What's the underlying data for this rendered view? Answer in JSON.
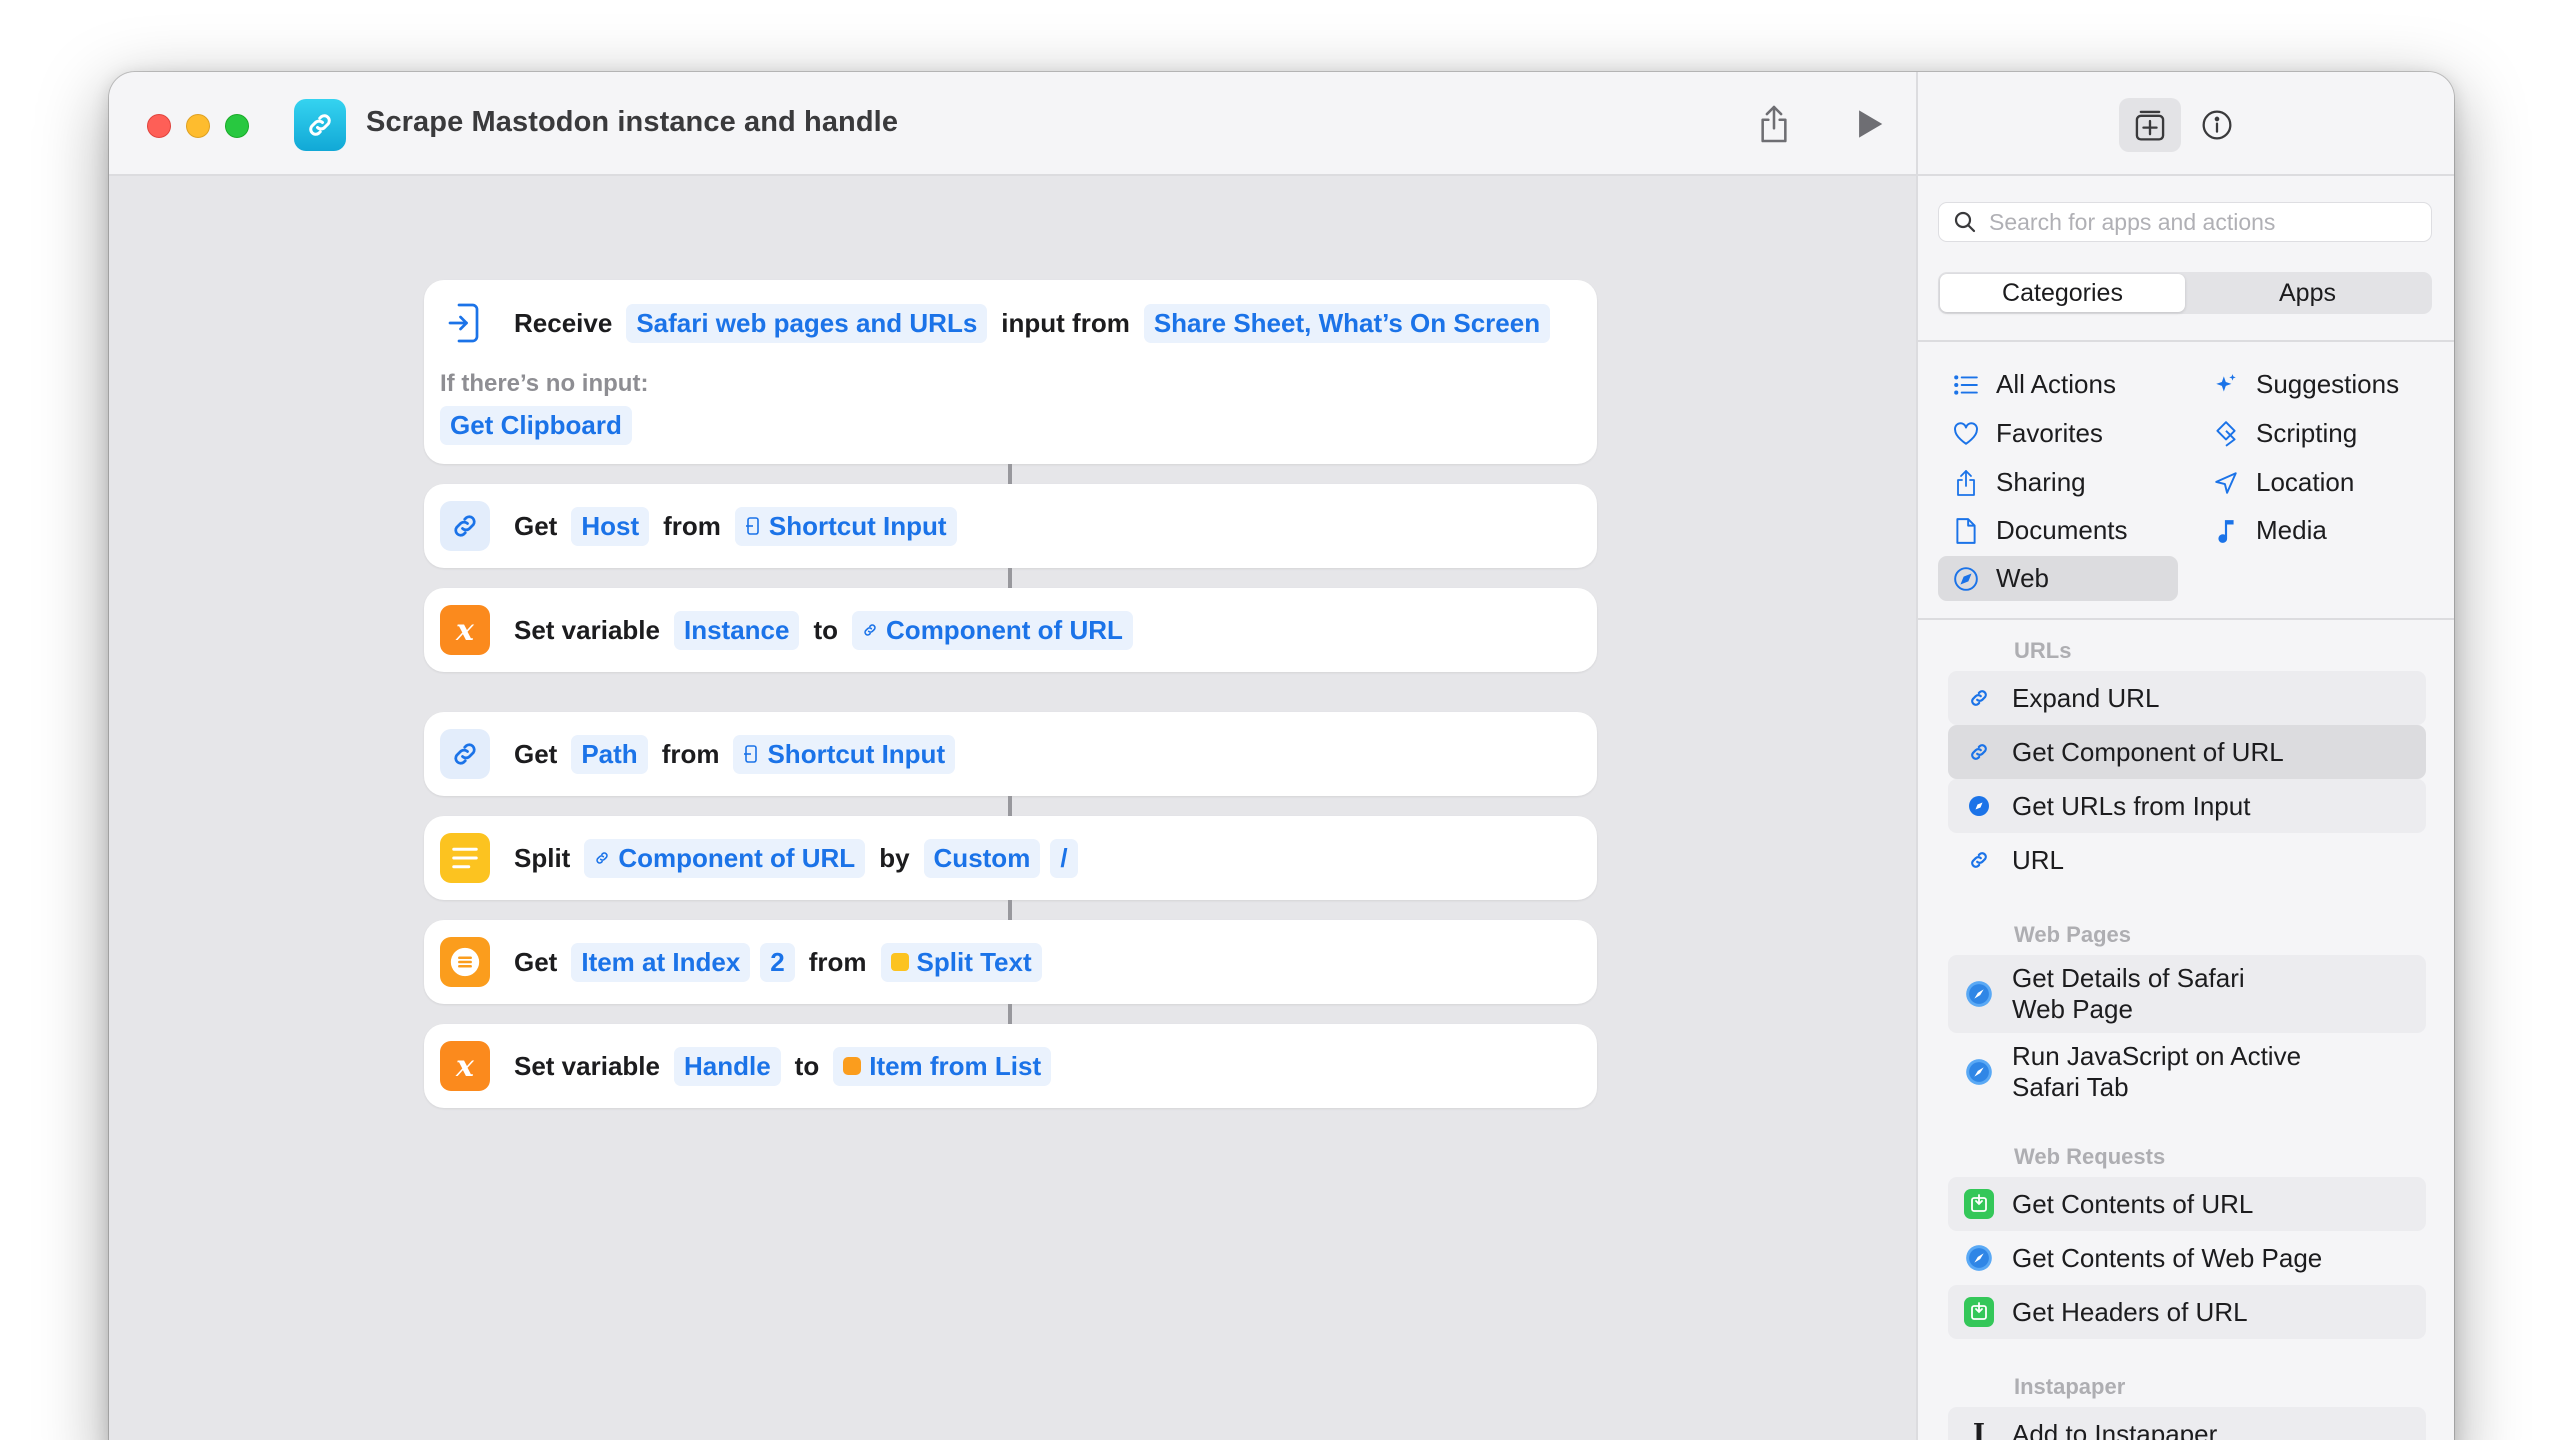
{
  "window": {
    "title": "Scrape Mastodon instance and handle"
  },
  "toolbar": {
    "share_icon": "share-icon",
    "run_icon": "play-icon"
  },
  "actions": {
    "receive": {
      "verb": "Receive",
      "input_types": "Safari web pages and URLs",
      "mid": "input from",
      "sources": "Share Sheet, What’s On Screen",
      "no_input_label": "If there’s no input:",
      "fallback": "Get Clipboard"
    },
    "get_host": {
      "verb": "Get",
      "component": "Host",
      "mid": "from",
      "source": "Shortcut Input"
    },
    "set_instance": {
      "verb": "Set variable",
      "name": "Instance",
      "mid": "to",
      "value": "Component of URL"
    },
    "get_path": {
      "verb": "Get",
      "component": "Path",
      "mid": "from",
      "source": "Shortcut Input"
    },
    "split": {
      "verb": "Split",
      "source": "Component of URL",
      "mid": "by",
      "mode": "Custom",
      "separator": "/"
    },
    "get_item": {
      "verb": "Get",
      "which": "Item at Index",
      "index": "2",
      "mid": "from",
      "source": "Split Text"
    },
    "set_handle": {
      "verb": "Set variable",
      "name": "Handle",
      "mid": "to",
      "value": "Item from List"
    }
  },
  "sidebar": {
    "search_placeholder": "Search for apps and actions",
    "tabs": [
      "Categories",
      "Apps"
    ],
    "active_tab": "Categories",
    "categories_left": [
      "All Actions",
      "Favorites",
      "Sharing",
      "Documents",
      "Web"
    ],
    "categories_right": [
      "Suggestions",
      "Scripting",
      "Location",
      "Media"
    ],
    "selected_category": "Web",
    "sections": {
      "urls": {
        "title": "URLs",
        "items": [
          "Expand URL",
          "Get Component of URL",
          "Get URLs from Input",
          "URL"
        ]
      },
      "web_pages": {
        "title": "Web Pages",
        "items": [
          "Get Details of Safari\nWeb Page",
          "Run JavaScript on Active\nSafari Tab"
        ]
      },
      "web_requests": {
        "title": "Web Requests",
        "items": [
          "Get Contents of URL",
          "Get Contents of Web Page",
          "Get Headers of URL"
        ]
      },
      "instapaper": {
        "title": "Instapaper",
        "items": [
          "Add to Instapaper"
        ]
      }
    }
  },
  "colors": {
    "accent": "#1b73e8",
    "orange": "#fb8a1d",
    "yellow": "#fcc320",
    "green": "#34c759"
  }
}
